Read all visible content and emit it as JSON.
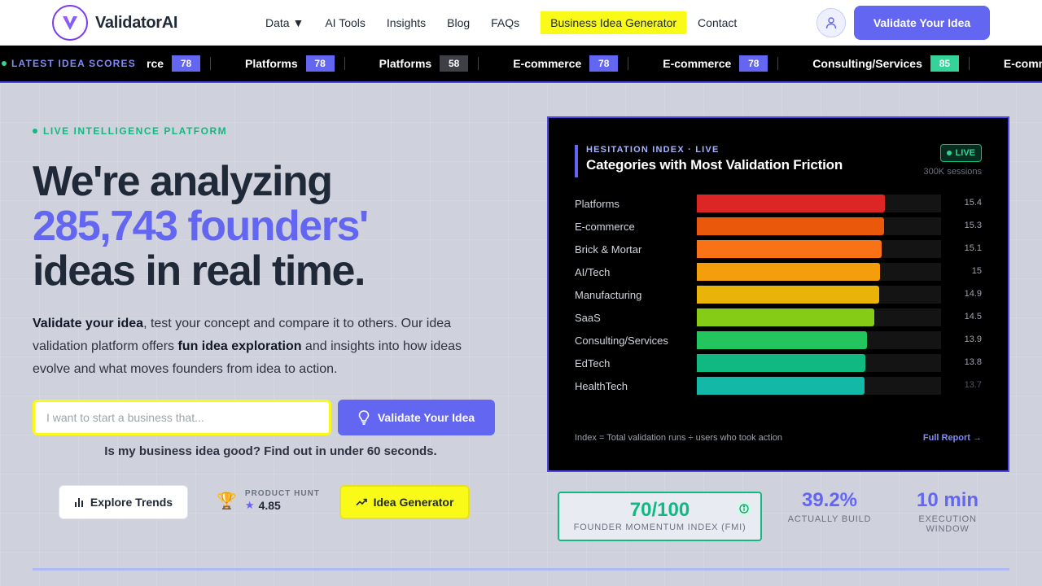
{
  "brand": {
    "name": "ValidatorAI",
    "logo_letter": "V"
  },
  "nav": {
    "items": [
      "Data ▼",
      "AI Tools",
      "Insights",
      "Blog",
      "FAQs",
      "Business Idea Generator",
      "Contact"
    ],
    "cta": "Validate Your Idea"
  },
  "ticker": {
    "label": "LATEST IDEA SCORES",
    "items": [
      {
        "name": "rce",
        "score": "78",
        "color": "#6366f1"
      },
      {
        "name": "Platforms",
        "score": "78",
        "color": "#6366f1"
      },
      {
        "name": "Platforms",
        "score": "58",
        "color": "#3f3f46"
      },
      {
        "name": "E-commerce",
        "score": "78",
        "color": "#6366f1"
      },
      {
        "name": "E-commerce",
        "score": "78",
        "color": "#6366f1"
      },
      {
        "name": "Consulting/Services",
        "score": "85",
        "color": "#34d399"
      },
      {
        "name": "E-commerce",
        "score": "",
        "color": "#6366f1"
      }
    ]
  },
  "hero": {
    "eyebrow": "LIVE INTELLIGENCE PLATFORM",
    "headline_1": "We're analyzing",
    "headline_2": "285,743 founders'",
    "headline_3": "ideas in real time.",
    "lead_bold_1": "Validate your idea",
    "lead_text_1": ", test your concept and compare it to others. Our idea validation platform offers ",
    "lead_bold_2": "fun idea exploration",
    "lead_text_2": " and insights into how ideas evolve and what moves founders from idea to action.",
    "input_placeholder": "I want to start a business that...",
    "validate_label": "Validate Your Idea",
    "subline": "Is my business idea good? Find out in under 60 seconds.",
    "explore_label": "Explore Trends",
    "ph_label": "PRODUCT HUNT",
    "ph_rating": "4.85",
    "generator_label": "Idea Generator"
  },
  "panel": {
    "kicker": "HESITATION INDEX · LIVE",
    "title": "Categories with Most Validation Friction",
    "live": "LIVE",
    "sessions": "300K sessions",
    "footnote": "Index = Total validation runs ÷ users who took action",
    "link": "Full Report →"
  },
  "chart_data": {
    "type": "bar",
    "title": "Categories with Most Validation Friction",
    "categories": [
      "Platforms",
      "E-commerce",
      "Brick & Mortar",
      "AI/Tech",
      "Manufacturing",
      "SaaS",
      "Consulting/Services",
      "EdTech",
      "HealthTech"
    ],
    "values": [
      15.4,
      15.3,
      15.1,
      15,
      14.9,
      14.5,
      13.9,
      13.8,
      13.7
    ],
    "colors": [
      "#dc2626",
      "#ea580c",
      "#f97316",
      "#f59e0b",
      "#eab308",
      "#84cc16",
      "#22c55e",
      "#10b981",
      "#14b8a6"
    ],
    "orientation": "horizontal",
    "xlim": [
      0,
      20
    ]
  },
  "stats": {
    "fmi_value": "70/100",
    "fmi_label": "FOUNDER MOMENTUM INDEX (FMI)",
    "build_value": "39.2%",
    "build_label": "ACTUALLY BUILD",
    "window_value": "10 min",
    "window_label": "EXECUTION WINDOW"
  }
}
